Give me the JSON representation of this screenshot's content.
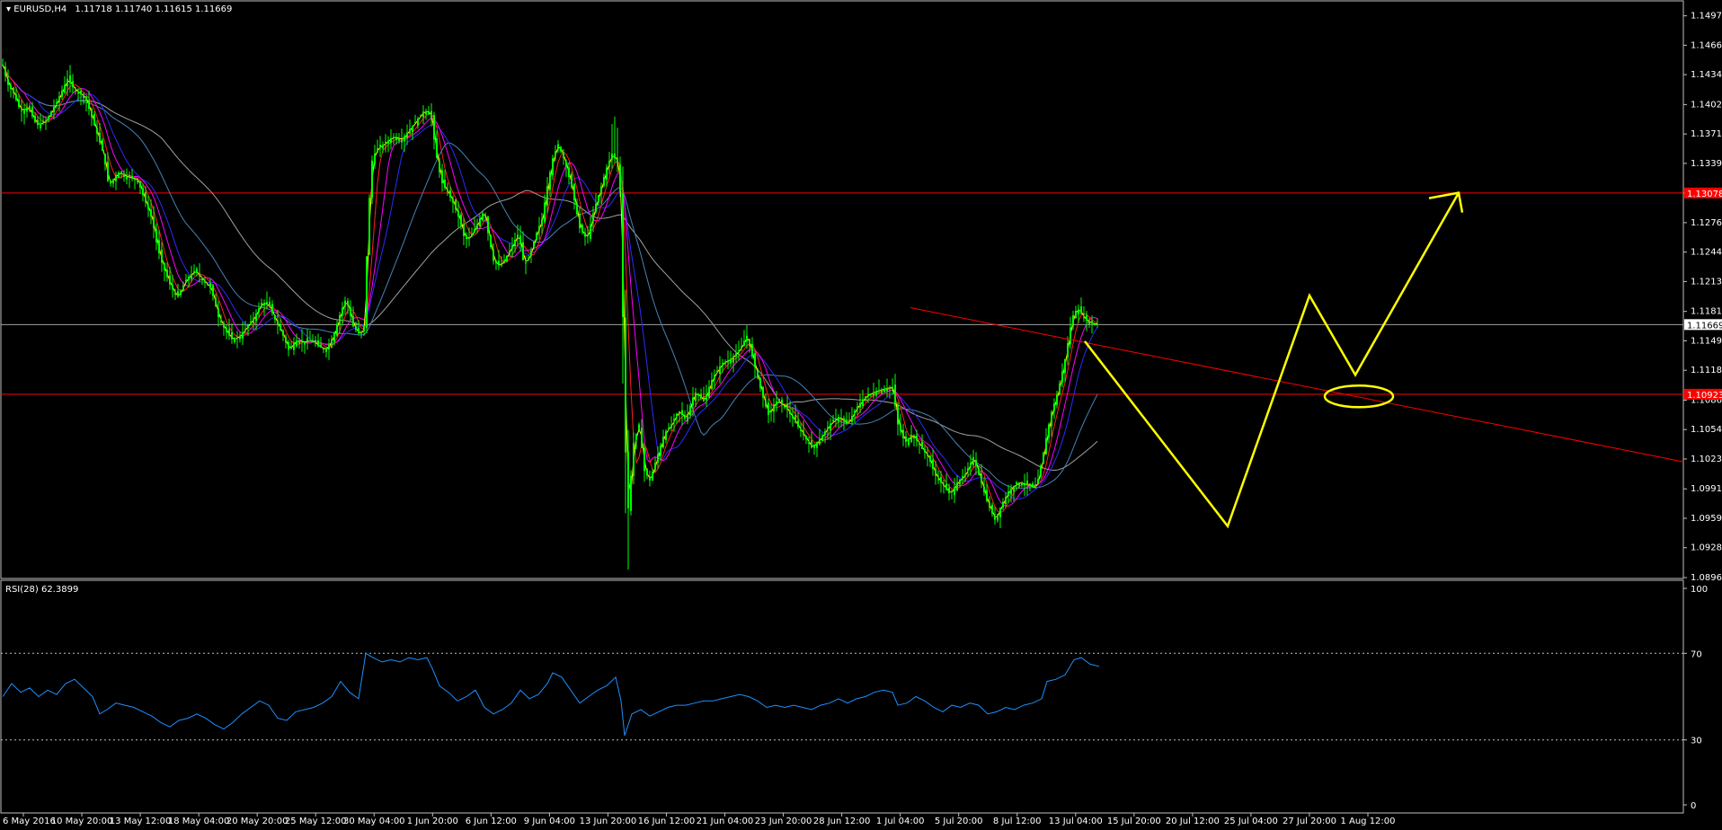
{
  "header": {
    "symbol_label": "EURUSD,H4",
    "ohlc": "1.11718 1.11740 1.11615 1.11669",
    "rsi_label": "RSI(28) 62.3899"
  },
  "colors": {
    "background": "#000000",
    "frame": "#c0c0c0",
    "candle": "#00ff00",
    "ma_fast": "#ffff00",
    "ma_red": "#ff2020",
    "ma_magenta": "#ff00ff",
    "ma_blue": "#2b2bff",
    "ma_steel": "#4682b4",
    "ma_slow": "#a0a0a0",
    "hline": "#ff0000",
    "annotation": "#ffff00",
    "rsi": "#1e90ff"
  },
  "chart_data": {
    "type": "candlestick",
    "symbol": "EURUSD",
    "timeframe": "H4",
    "price_ticks": [
      "1.14975",
      "1.14660",
      "1.14345",
      "1.14025",
      "1.13710",
      "1.13395",
      "1.13078",
      "1.12760",
      "1.12445",
      "1.12130",
      "1.11810",
      "1.11495",
      "1.11180",
      "1.10860",
      "1.10545",
      "1.10230",
      "1.09910",
      "1.09595",
      "1.09280",
      "1.08960"
    ],
    "ylim": [
      1.0896,
      1.15
    ],
    "current_price": 1.11669,
    "current_price_label": "1.11669",
    "horizontal_lines": [
      {
        "value": 1.13078,
        "label": "1.13078"
      },
      {
        "value": 1.10923,
        "label": "1.10923"
      }
    ],
    "time_labels": [
      "6 May 2016",
      "10 May 20:00",
      "13 May 12:00",
      "18 May 04:00",
      "20 May 20:00",
      "25 May 12:00",
      "30 May 04:00",
      "1 Jun 20:00",
      "6 Jun 12:00",
      "9 Jun 04:00",
      "13 Jun 20:00",
      "16 Jun 12:00",
      "21 Jun 04:00",
      "23 Jun 20:00",
      "28 Jun 12:00",
      "1 Jul 04:00",
      "5 Jul 20:00",
      "8 Jul 12:00",
      "13 Jul 04:00",
      "15 Jul 20:00",
      "20 Jul 12:00",
      "25 Jul 04:00",
      "27 Jul 20:00",
      "1 Aug 12:00"
    ],
    "price_path": [
      [
        0,
        1.1445
      ],
      [
        5,
        1.1425
      ],
      [
        12,
        1.1415
      ],
      [
        20,
        1.1395
      ],
      [
        28,
        1.14
      ],
      [
        38,
        1.138
      ],
      [
        48,
        1.1385
      ],
      [
        60,
        1.1405
      ],
      [
        72,
        1.143
      ],
      [
        80,
        1.1418
      ],
      [
        92,
        1.141
      ],
      [
        102,
        1.138
      ],
      [
        112,
        1.135
      ],
      [
        118,
        1.1315
      ],
      [
        128,
        1.133
      ],
      [
        138,
        1.1325
      ],
      [
        150,
        1.1322
      ],
      [
        158,
        1.13
      ],
      [
        166,
        1.128
      ],
      [
        172,
        1.125
      ],
      [
        178,
        1.123
      ],
      [
        186,
        1.121
      ],
      [
        194,
        1.1195
      ],
      [
        204,
        1.1215
      ],
      [
        214,
        1.1225
      ],
      [
        222,
        1.1215
      ],
      [
        232,
        1.1205
      ],
      [
        240,
        1.1175
      ],
      [
        248,
        1.116
      ],
      [
        256,
        1.115
      ],
      [
        264,
        1.1155
      ],
      [
        272,
        1.1165
      ],
      [
        280,
        1.1175
      ],
      [
        288,
        1.119
      ],
      [
        296,
        1.1188
      ],
      [
        304,
        1.117
      ],
      [
        312,
        1.1155
      ],
      [
        318,
        1.114
      ],
      [
        326,
        1.115
      ],
      [
        334,
        1.1148
      ],
      [
        344,
        1.115
      ],
      [
        352,
        1.1143
      ],
      [
        360,
        1.114
      ],
      [
        368,
        1.1155
      ],
      [
        376,
        1.118
      ],
      [
        382,
        1.1195
      ],
      [
        390,
        1.1165
      ],
      [
        398,
        1.1155
      ],
      [
        402,
        1.1165
      ],
      [
        406,
        1.1265
      ],
      [
        410,
        1.134
      ],
      [
        416,
        1.1355
      ],
      [
        424,
        1.136
      ],
      [
        434,
        1.1368
      ],
      [
        444,
        1.1365
      ],
      [
        452,
        1.1375
      ],
      [
        460,
        1.1385
      ],
      [
        468,
        1.1395
      ],
      [
        476,
        1.1395
      ],
      [
        482,
        1.135
      ],
      [
        488,
        1.132
      ],
      [
        494,
        1.131
      ],
      [
        500,
        1.13
      ],
      [
        508,
        1.128
      ],
      [
        514,
        1.1258
      ],
      [
        520,
        1.126
      ],
      [
        528,
        1.1275
      ],
      [
        536,
        1.129
      ],
      [
        540,
        1.1265
      ],
      [
        546,
        1.1235
      ],
      [
        552,
        1.123
      ],
      [
        558,
        1.1235
      ],
      [
        566,
        1.125
      ],
      [
        574,
        1.1265
      ],
      [
        580,
        1.123
      ],
      [
        586,
        1.124
      ],
      [
        594,
        1.1265
      ],
      [
        600,
        1.128
      ],
      [
        606,
        1.1315
      ],
      [
        612,
        1.1345
      ],
      [
        618,
        1.136
      ],
      [
        626,
        1.134
      ],
      [
        634,
        1.131
      ],
      [
        642,
        1.127
      ],
      [
        650,
        1.1258
      ],
      [
        658,
        1.129
      ],
      [
        666,
        1.1315
      ],
      [
        672,
        1.1335
      ],
      [
        678,
        1.135
      ],
      [
        684,
        1.134
      ],
      [
        688,
        1.13
      ],
      [
        692,
        1.105
      ],
      [
        696,
        1.097
      ],
      [
        702,
        1.104
      ],
      [
        708,
        1.106
      ],
      [
        714,
        1.101
      ],
      [
        720,
        1.1
      ],
      [
        728,
        1.1025
      ],
      [
        736,
        1.105
      ],
      [
        744,
        1.106
      ],
      [
        752,
        1.1075
      ],
      [
        760,
        1.1065
      ],
      [
        770,
        1.1095
      ],
      [
        780,
        1.1085
      ],
      [
        790,
        1.111
      ],
      [
        800,
        1.1125
      ],
      [
        810,
        1.113
      ],
      [
        820,
        1.114
      ],
      [
        828,
        1.1155
      ],
      [
        836,
        1.1125
      ],
      [
        844,
        1.1095
      ],
      [
        852,
        1.107
      ],
      [
        860,
        1.1085
      ],
      [
        870,
        1.108
      ],
      [
        880,
        1.1065
      ],
      [
        890,
        1.105
      ],
      [
        900,
        1.1035
      ],
      [
        910,
        1.1045
      ],
      [
        920,
        1.106
      ],
      [
        930,
        1.1068
      ],
      [
        940,
        1.106
      ],
      [
        950,
        1.1078
      ],
      [
        960,
        1.109
      ],
      [
        970,
        1.1095
      ],
      [
        980,
        1.1098
      ],
      [
        990,
        1.11
      ],
      [
        996,
        1.106
      ],
      [
        1004,
        1.104
      ],
      [
        1012,
        1.105
      ],
      [
        1022,
        1.1035
      ],
      [
        1030,
        1.1025
      ],
      [
        1038,
        1.1005
      ],
      [
        1046,
        1.0995
      ],
      [
        1054,
        1.0985
      ],
      [
        1062,
        1.0998
      ],
      [
        1070,
        1.1005
      ],
      [
        1080,
        1.1025
      ],
      [
        1088,
        1.1
      ],
      [
        1096,
        1.0975
      ],
      [
        1104,
        1.0958
      ],
      [
        1112,
        1.0975
      ],
      [
        1120,
        1.099
      ],
      [
        1130,
        1.0998
      ],
      [
        1140,
        1.0995
      ],
      [
        1150,
        1.0992
      ],
      [
        1158,
        1.103
      ],
      [
        1166,
        1.107
      ],
      [
        1174,
        1.1095
      ],
      [
        1182,
        1.113
      ],
      [
        1190,
        1.1175
      ],
      [
        1196,
        1.1185
      ],
      [
        1204,
        1.1172
      ],
      [
        1212,
        1.1168
      ],
      [
        1220,
        1.1167
      ]
    ],
    "rsi": {
      "name": "RSI(28)",
      "last_value": 62.3899,
      "ylim": [
        0,
        100
      ],
      "levels": [
        30,
        70
      ],
      "tick_labels": [
        "100",
        "70",
        "30",
        "0"
      ],
      "values": [
        [
          0,
          50
        ],
        [
          10,
          56
        ],
        [
          20,
          52
        ],
        [
          30,
          54
        ],
        [
          40,
          50
        ],
        [
          50,
          53
        ],
        [
          60,
          51
        ],
        [
          70,
          56
        ],
        [
          80,
          58
        ],
        [
          90,
          54
        ],
        [
          100,
          50
        ],
        [
          108,
          42
        ],
        [
          116,
          44
        ],
        [
          126,
          47
        ],
        [
          136,
          46
        ],
        [
          146,
          45
        ],
        [
          156,
          43
        ],
        [
          166,
          41
        ],
        [
          176,
          38
        ],
        [
          186,
          36
        ],
        [
          196,
          39
        ],
        [
          206,
          40
        ],
        [
          216,
          42
        ],
        [
          226,
          40
        ],
        [
          236,
          37
        ],
        [
          246,
          35
        ],
        [
          256,
          38
        ],
        [
          266,
          42
        ],
        [
          276,
          45
        ],
        [
          286,
          48
        ],
        [
          296,
          46
        ],
        [
          306,
          40
        ],
        [
          316,
          39
        ],
        [
          326,
          43
        ],
        [
          336,
          44
        ],
        [
          346,
          45
        ],
        [
          356,
          47
        ],
        [
          366,
          50
        ],
        [
          376,
          57
        ],
        [
          386,
          52
        ],
        [
          396,
          49
        ],
        [
          404,
          70
        ],
        [
          412,
          68
        ],
        [
          422,
          66
        ],
        [
          432,
          67
        ],
        [
          442,
          66
        ],
        [
          452,
          68
        ],
        [
          462,
          67
        ],
        [
          472,
          68
        ],
        [
          478,
          63
        ],
        [
          486,
          55
        ],
        [
          496,
          52
        ],
        [
          506,
          48
        ],
        [
          516,
          50
        ],
        [
          526,
          53
        ],
        [
          536,
          45
        ],
        [
          546,
          42
        ],
        [
          556,
          44
        ],
        [
          566,
          47
        ],
        [
          576,
          53
        ],
        [
          586,
          49
        ],
        [
          596,
          51
        ],
        [
          606,
          56
        ],
        [
          612,
          61
        ],
        [
          622,
          59
        ],
        [
          632,
          53
        ],
        [
          642,
          47
        ],
        [
          652,
          50
        ],
        [
          662,
          53
        ],
        [
          672,
          55
        ],
        [
          682,
          59
        ],
        [
          688,
          48
        ],
        [
          692,
          32
        ],
        [
          700,
          42
        ],
        [
          710,
          44
        ],
        [
          720,
          41
        ],
        [
          730,
          43
        ],
        [
          740,
          45
        ],
        [
          750,
          46
        ],
        [
          760,
          46
        ],
        [
          770,
          47
        ],
        [
          780,
          48
        ],
        [
          790,
          48
        ],
        [
          800,
          49
        ],
        [
          810,
          50
        ],
        [
          820,
          51
        ],
        [
          830,
          50
        ],
        [
          840,
          48
        ],
        [
          850,
          45
        ],
        [
          860,
          46
        ],
        [
          870,
          45
        ],
        [
          880,
          46
        ],
        [
          890,
          45
        ],
        [
          900,
          44
        ],
        [
          910,
          46
        ],
        [
          920,
          47
        ],
        [
          930,
          49
        ],
        [
          940,
          47
        ],
        [
          950,
          49
        ],
        [
          960,
          50
        ],
        [
          970,
          52
        ],
        [
          980,
          53
        ],
        [
          990,
          52
        ],
        [
          996,
          46
        ],
        [
          1006,
          47
        ],
        [
          1016,
          50
        ],
        [
          1026,
          48
        ],
        [
          1036,
          45
        ],
        [
          1046,
          43
        ],
        [
          1056,
          46
        ],
        [
          1066,
          45
        ],
        [
          1076,
          47
        ],
        [
          1086,
          46
        ],
        [
          1096,
          42
        ],
        [
          1106,
          43
        ],
        [
          1116,
          45
        ],
        [
          1126,
          44
        ],
        [
          1136,
          46
        ],
        [
          1146,
          47
        ],
        [
          1156,
          49
        ],
        [
          1162,
          57
        ],
        [
          1172,
          58
        ],
        [
          1182,
          60
        ],
        [
          1192,
          67
        ],
        [
          1200,
          68
        ],
        [
          1210,
          65
        ],
        [
          1220,
          64
        ]
      ]
    }
  }
}
